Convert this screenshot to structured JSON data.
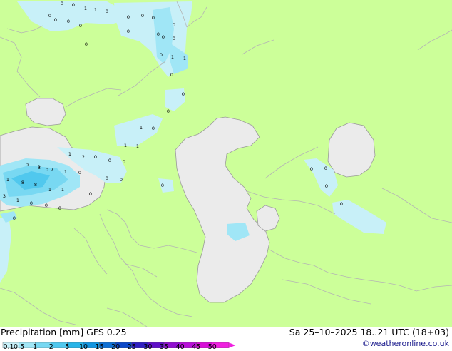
{
  "title": {
    "left": "Precipitation [mm]  GFS 0.25",
    "right": "Sa 25–10–2025 18..21 UTC (18+03)"
  },
  "credit": "©weatheronline.co.uk",
  "legend": {
    "ticks": [
      "0.1",
      "0.5",
      "1",
      "2",
      "5",
      "10",
      "15",
      "20",
      "25",
      "30",
      "35",
      "40",
      "45",
      "50"
    ],
    "colors": [
      "#c8f0f8",
      "#a0e6f6",
      "#78d8f2",
      "#50c8ee",
      "#28b4e8",
      "#1496e0",
      "#1070d4",
      "#0c48c8",
      "#3020c0",
      "#6010c8",
      "#9010d0",
      "#b810d8",
      "#d810d8",
      "#f020e0"
    ]
  },
  "map": {
    "colors": {
      "land": "#ccff99",
      "water": "#ebebeb",
      "border": "#b4b4b4",
      "coast": "#9a9a9a"
    },
    "value_labels": [
      "0",
      "0",
      "0",
      "1",
      "0",
      "0",
      "1",
      "0",
      "0",
      "0",
      "0",
      "0",
      "0",
      "0",
      "0",
      "0",
      "0",
      "0",
      "0",
      "1",
      "0",
      "1",
      "0",
      "1",
      "1",
      "0",
      "0",
      "1",
      "0",
      "0",
      "0",
      "1",
      "2",
      "0",
      "0",
      "0",
      "1",
      "0",
      "3",
      "7",
      "1",
      "0",
      "0",
      "1",
      "8",
      "8",
      "1",
      "3",
      "1",
      "1",
      "0",
      "0",
      "0",
      "0",
      "0",
      "0",
      "0",
      "0",
      "0"
    ]
  }
}
